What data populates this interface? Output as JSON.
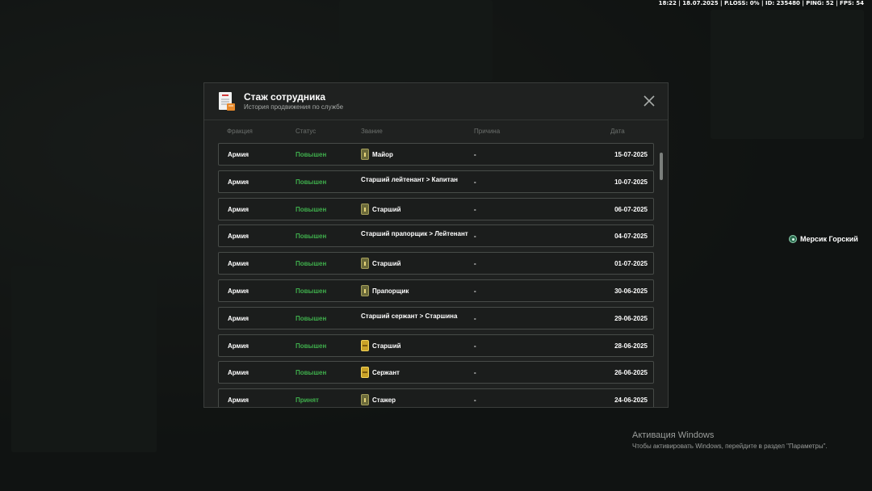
{
  "hud": {
    "stats": "18:22 | 18.07.2025 | P.LOSS: 0% | ID: 235480 | PING: 52 | FPS: 54"
  },
  "modal": {
    "title": "Стаж сотрудника",
    "subtitle": "История продвижения по службе",
    "icon": "document-badge-icon",
    "close_icon": "close-icon",
    "columns": {
      "faction": "Фракция",
      "status": "Статус",
      "rank": "Звание",
      "reason": "Причина",
      "date": "Дата"
    },
    "rows": [
      {
        "faction": "Армия",
        "status": "Повышен",
        "rank": "Майор",
        "badge": "olive",
        "reason": "-",
        "date": "15-07-2025"
      },
      {
        "faction": "Армия",
        "status": "Повышен",
        "rank": "Старший лейтенант > Капитан",
        "badge": "",
        "reason": "-",
        "date": "10-07-2025"
      },
      {
        "faction": "Армия",
        "status": "Повышен",
        "rank": "Старший",
        "badge": "olive",
        "reason": "-",
        "date": "06-07-2025"
      },
      {
        "faction": "Армия",
        "status": "Повышен",
        "rank": "Старший прапорщик > Лейтенант",
        "badge": "",
        "reason": "-",
        "date": "04-07-2025"
      },
      {
        "faction": "Армия",
        "status": "Повышен",
        "rank": "Старший",
        "badge": "olive",
        "reason": "-",
        "date": "01-07-2025"
      },
      {
        "faction": "Армия",
        "status": "Повышен",
        "rank": "Прапорщик",
        "badge": "olive",
        "reason": "-",
        "date": "30-06-2025"
      },
      {
        "faction": "Армия",
        "status": "Повышен",
        "rank": "Старший сержант > Старшина",
        "badge": "",
        "reason": "-",
        "date": "29-06-2025"
      },
      {
        "faction": "Армия",
        "status": "Повышен",
        "rank": "Старший",
        "badge": "gold",
        "reason": "-",
        "date": "28-06-2025"
      },
      {
        "faction": "Армия",
        "status": "Повышен",
        "rank": "Сержант",
        "badge": "gold",
        "reason": "-",
        "date": "26-06-2025"
      },
      {
        "faction": "Армия",
        "status": "Принят",
        "rank": "Стажер",
        "badge": "olive",
        "reason": "-",
        "date": "24-06-2025"
      }
    ]
  },
  "nameplate": {
    "name": "Мерсик Горский"
  },
  "windows_activation": {
    "title": "Активация Windows",
    "text": "Чтобы активировать Windows, перейдите в раздел \"Параметры\"."
  },
  "colors": {
    "status_green": "#3fae4c",
    "modal_bg": "#1f2120",
    "row_border": "#474b48"
  }
}
